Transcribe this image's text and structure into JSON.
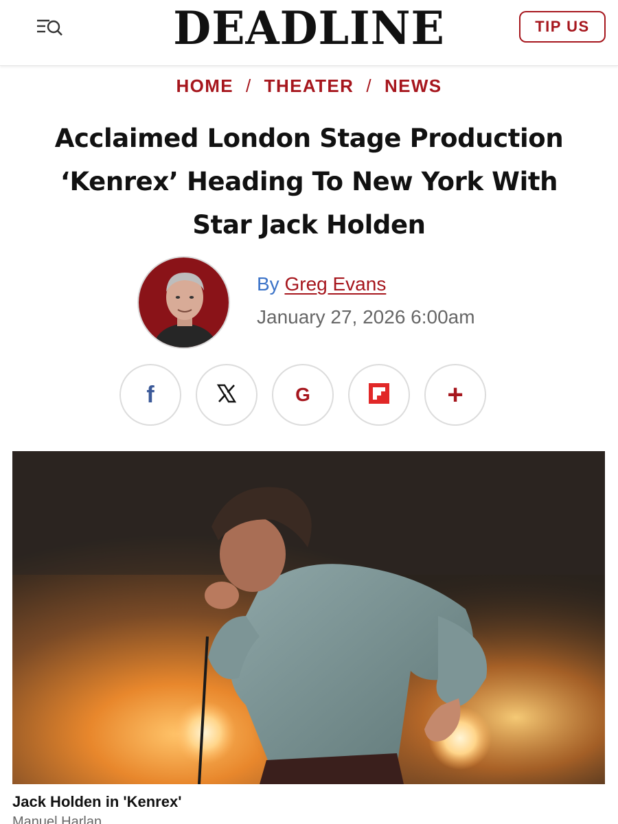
{
  "header": {
    "logo": "DEADLINE",
    "tip_label": "TIP US"
  },
  "breadcrumb": {
    "items": [
      "HOME",
      "THEATER",
      "NEWS"
    ],
    "separator": "/"
  },
  "article": {
    "title_lines": [
      "Acclaimed London Stage Production",
      "‘Kenrex’ Heading To New York With",
      "Star Jack Holden"
    ],
    "by_prefix": "By",
    "author": "Greg Evans",
    "date": "January 27, 2026 6:00am"
  },
  "share": [
    {
      "name": "facebook-icon",
      "glyph": "f",
      "color": "#3b5998"
    },
    {
      "name": "x-icon",
      "glyph": "𝕏",
      "color": "#111111"
    },
    {
      "name": "google-icon",
      "glyph": "G",
      "color": "#a6161d"
    },
    {
      "name": "flipboard-icon",
      "glyph": "",
      "color": "#e12828"
    },
    {
      "name": "plus-icon",
      "glyph": "+",
      "color": "#a6161d"
    }
  ],
  "media": {
    "caption": "Jack Holden in 'Kenrex'",
    "credit": "Manuel Harlan"
  },
  "colors": {
    "accent": "#a6161d",
    "byline_blue": "#3b73c8"
  }
}
